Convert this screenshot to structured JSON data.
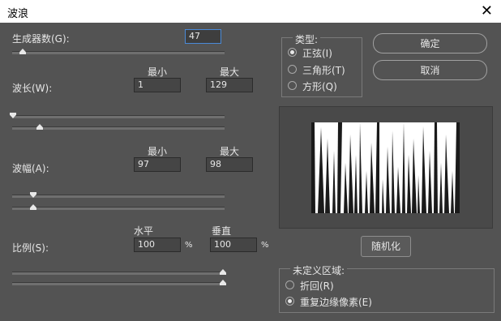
{
  "window": {
    "title": "波浪",
    "close_glyph": "✕"
  },
  "generators": {
    "label": "生成器数(G):",
    "value": "47"
  },
  "wavelength": {
    "label": "波长(W):",
    "min_label": "最小",
    "max_label": "最大",
    "min_value": "1",
    "max_value": "129",
    "min_slider_fraction": 0.0,
    "max_slider_fraction": 0.13
  },
  "amplitude": {
    "label": "波幅(A):",
    "min_label": "最小",
    "max_label": "最大",
    "min_value": "97",
    "max_value": "98",
    "min_slider_fraction": 0.1,
    "max_slider_fraction": 0.1
  },
  "scale": {
    "label": "比例(S):",
    "h_label": "水平",
    "v_label": "垂直",
    "h_value": "100",
    "v_value": "100",
    "unit": "%",
    "h_slider_fraction": 1.0,
    "v_slider_fraction": 1.0
  },
  "type_group": {
    "legend": "类型:",
    "options": [
      {
        "label": "正弦(I)",
        "checked": true
      },
      {
        "label": "三角形(T)",
        "checked": false
      },
      {
        "label": "方形(Q)",
        "checked": false
      }
    ]
  },
  "buttons": {
    "ok": "确定",
    "cancel": "取消",
    "randomize": "随机化"
  },
  "undefined_group": {
    "legend": "未定义区域:",
    "options": [
      {
        "label": "折回(R)",
        "checked": false
      },
      {
        "label": "重复边缘像素(E)",
        "checked": true
      }
    ]
  },
  "icons": {
    "close": "close-icon",
    "radio": "radio-icon",
    "thumb": "slider-thumb-icon"
  },
  "colors": {
    "background": "#535353",
    "field": "#454545",
    "focus_border": "#4a8ad8",
    "text": "#e6e6e6"
  }
}
